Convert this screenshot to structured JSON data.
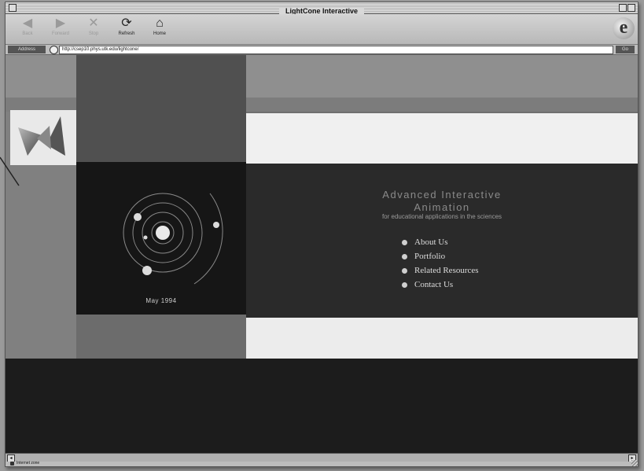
{
  "window": {
    "title": "LightCone Interactive"
  },
  "toolbar": {
    "buttons": [
      {
        "label": "Back",
        "icon": "back-arrow-icon",
        "glyph": "◀",
        "enabled": false
      },
      {
        "label": "Forward",
        "icon": "forward-arrow-icon",
        "glyph": "▶",
        "enabled": false
      },
      {
        "label": "Stop",
        "icon": "stop-icon",
        "glyph": "✕",
        "enabled": false
      },
      {
        "label": "Refresh",
        "icon": "refresh-icon",
        "glyph": "⟳",
        "enabled": true
      },
      {
        "label": "Home",
        "icon": "home-icon",
        "glyph": "⌂",
        "enabled": true
      }
    ],
    "browser_logo": "e"
  },
  "address": {
    "label": "Address",
    "url": "http://csep10.phys.utk.edu/lightcone/",
    "go_label": "Go"
  },
  "page": {
    "headline_line1": "Advanced Interactive",
    "headline_line2": "Animation",
    "subhead": "for educational applications in the sciences",
    "nav": [
      "About Us",
      "Portfolio",
      "Related Resources",
      "Contact Us"
    ],
    "date": "May 1994"
  },
  "status": {
    "text": "Internet zone"
  },
  "colors": {
    "page_dark": "#2a2a2a",
    "nav_text": "#dcdcdc",
    "headline_text": "#8a8a8a"
  }
}
